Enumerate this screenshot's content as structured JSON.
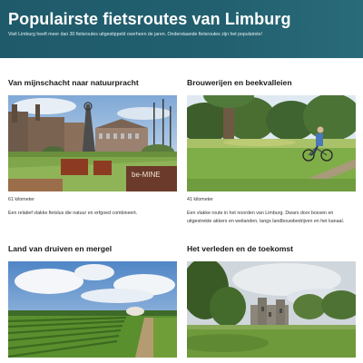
{
  "header": {
    "title": "Populairste fietsroutes van Limburg",
    "intro": "Visit Limburg heeft meer dan 30 fietsroutes uitgestippeld overheen de jaren. Onderstaande fietsroutes zijn het populairste!"
  },
  "routes": [
    {
      "title": "Van mijnschacht naar natuurpracht",
      "distance": "61 kilometer",
      "description": "Een relatief vlakke fietslus die natuur en erfgoed combineert.",
      "photo_sign": "be-MINE"
    },
    {
      "title": "Brouwerijen en beekvalleien",
      "distance": "41 kilometer",
      "description": "Een vlakke route in het noorden van Limburg. Dwars door bossen en uitgestrekte akkers en weilanden, langs landbouwbedrijven en het kanaal."
    },
    {
      "title": "Land van druiven en mergel"
    },
    {
      "title": "Het verleden en de toekomst"
    }
  ]
}
